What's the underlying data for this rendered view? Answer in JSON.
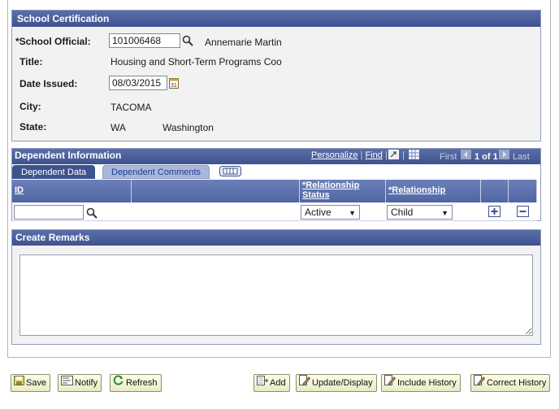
{
  "school_cert": {
    "title": "School Certification",
    "official_label": "*School Official:",
    "official_id": "101006468",
    "official_name": "Annemarie Martin",
    "title_label": "Title:",
    "title_value": "Housing and Short-Term Programs Coo",
    "date_label": "Date Issued:",
    "date_value": "08/03/2015",
    "city_label": "City:",
    "city_value": "TACOMA",
    "state_label": "State:",
    "state_code": "WA",
    "state_name": "Washington"
  },
  "dependent": {
    "title": "Dependent Information",
    "personalize": "Personalize",
    "find": "Find",
    "first": "First",
    "page_info": "1 of 1",
    "last": "Last",
    "tabs": [
      "Dependent Data",
      "Dependent Comments"
    ],
    "columns": {
      "id": "ID",
      "rel_status_1": "*Relationship",
      "rel_status_2": "Status",
      "relationship": "*Relationship"
    },
    "row": {
      "id_value": "",
      "rel_status": "Active",
      "relationship": "Child"
    }
  },
  "remarks": {
    "title": "Create Remarks",
    "text": ""
  },
  "buttons": {
    "save": "Save",
    "notify": "Notify",
    "refresh": "Refresh",
    "add": "Add",
    "update_display": "Update/Display",
    "include_history": "Include History",
    "correct_history": "Correct History"
  },
  "colors": {
    "header_bar": "#4a5d9a",
    "grid_header": "#5d72ad",
    "panel_bg": "#f2f2f2",
    "button_bg": "#f4f5d8"
  }
}
